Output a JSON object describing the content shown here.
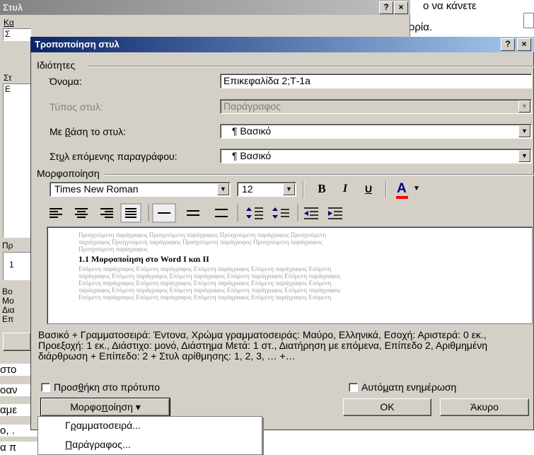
{
  "background_doc": {
    "frag1": "ο να κάνετε",
    "frag2": "ορία.",
    "frag3": "στο",
    "frag4": "οαν",
    "frag5": "αμε",
    "frag6": "ο, .",
    "frag7": "α π"
  },
  "bg_dialog": {
    "title": "Στυλ",
    "help_label": "?",
    "close_label": "×",
    "frag_k": "Κα",
    "frag_s": "Σ",
    "frag_st": "Στ",
    "frag_e": "Ε",
    "frag_pr": "Πρ",
    "frag_1": "1",
    "frag_bo": "Βο",
    "frag_mo": "Μο",
    "frag_di": "Δια",
    "frag_ep": "Επ"
  },
  "dialog": {
    "title": "Τροποποίηση στυλ",
    "help_label": "?",
    "close_label": "×",
    "properties_group": "Ιδιότητες",
    "name_label": "Όνομα:",
    "name_value": "Επικεφαλίδα 2;Τ-1a",
    "style_type_label": "Τύπος στυλ:",
    "style_type_value": "Παράγραφος",
    "based_on_label": "Με βάση το στυλ:",
    "based_on_value": "¶ Βασικό",
    "next_style_label": "Στυλ επόμενης παραγράφου:",
    "next_style_value": "¶ Βασικό",
    "formatting_group": "Μορφοποίηση",
    "font_name": "Times New Roman",
    "font_size": "12",
    "bold_label": "B",
    "italic_label": "I",
    "underline_label": "U",
    "font_color_label": "A",
    "preview": {
      "before_1": "Προηγούμενη παράγραφος Προηγούμενη παράγραφος Προηγούμενη παράγραφος Προηγούμενη",
      "before_2": "παράγραφος Προηγούμενη παράγραφος Προηγούμενη παράγραφος Προηγούμενη παράγραφος",
      "before_3": "Προηγούμενη παράγραφος",
      "sample": "1.1 Μορφοποίηση στο Word Ι και ΙΙ",
      "after_1": "Επόμενη παράγραφος Επόμενη παράγραφος Επόμενη παράγραφος Επόμενη παράγραφος Επόμενη",
      "after_2": "παράγραφος Επόμενη παράγραφος Επόμενη παράγραφος Επόμενη παράγραφος Επόμενη παράγραφος",
      "after_3": "Επόμενη παράγραφος Επόμενη παράγραφος Επόμενη παράγραφος Επόμενη παράγραφος Επόμενη",
      "after_4": "παράγραφος Επόμενη παράγραφος Επόμενη παράγραφος Επόμενη παράγραφος Επόμενη παράγραφος",
      "after_5": "Επόμενη παράγραφος Επόμενη παράγραφος Επόμενη παράγραφος Επόμενη παράγραφος Επόμενη"
    },
    "description": "Βασικό + Γραμματοσειρά: Έντονα, Χρώμα γραμματοσειράς: Μαύρο, Ελληνικά, Εσοχή: Αριστερά: 0 εκ., Προεξοχή: 1 εκ., Διάστιχο: μονό, Διάστημα Μετά: 1 στ., Διατήρηση με επόμενα, Επίπεδο 2, Αριθμημένη διάρθρωση + Επίπεδο: 2 + Στυλ αρίθμησης: 1, 2, 3, … +…",
    "add_to_template_label": "Προσθήκη στο πρότυπο",
    "auto_update_label": "Αυτόματη ενημέρωση",
    "format_button": "Μορφοποίηση ▾",
    "ok_button": "OK",
    "cancel_button": "Άκυρο"
  },
  "format_menu": {
    "items": [
      "Γραμματοσειρά...",
      "Παράγραφος..."
    ]
  },
  "colors": {
    "title_active": "#0a246a",
    "title_inactive": "#848284",
    "dialog_face": "#d4d0c8",
    "font_color": "#ff0000"
  }
}
